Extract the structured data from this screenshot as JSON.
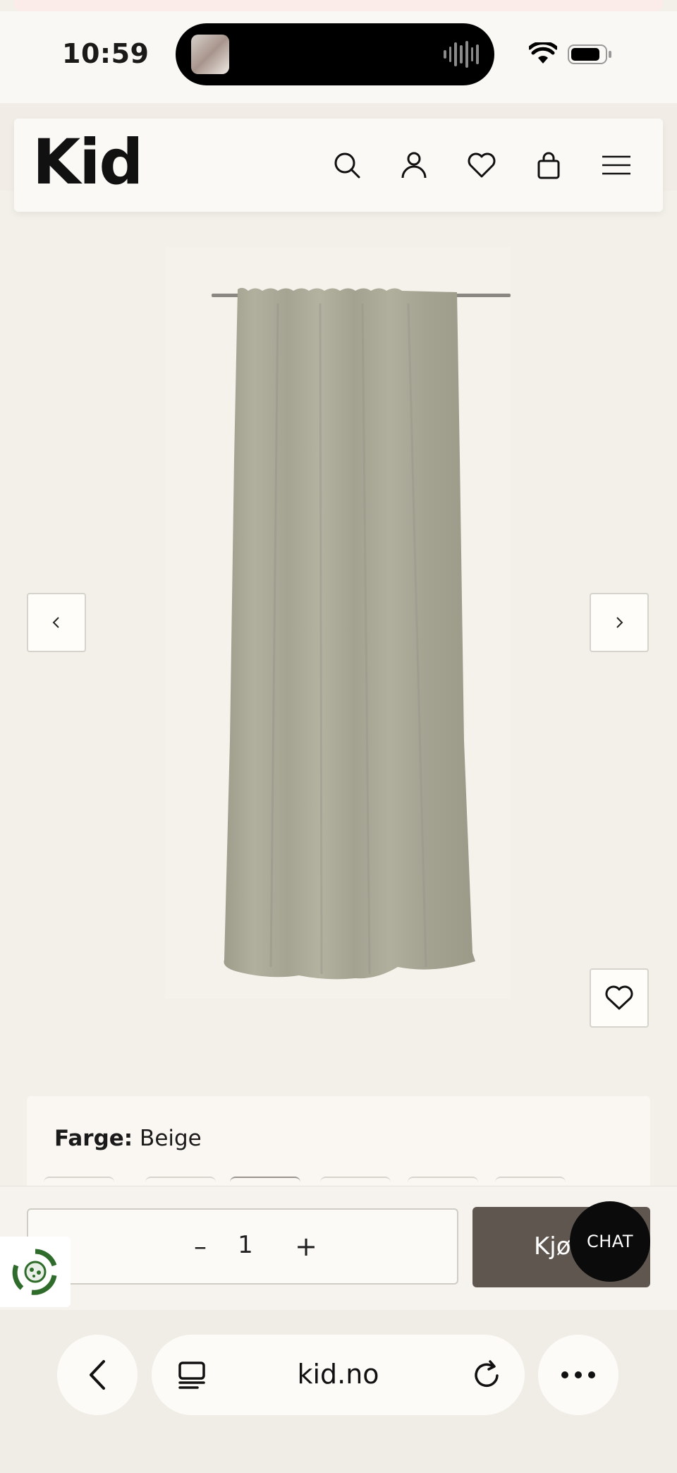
{
  "status_bar": {
    "time": "10:59"
  },
  "header": {
    "logo": "Kid",
    "icons": [
      "search-icon",
      "account-icon",
      "heart-icon",
      "bag-icon",
      "menu-icon"
    ]
  },
  "product": {
    "image_icon": "curtain-image",
    "color_label": "Farge:",
    "color_value": "Beige"
  },
  "buy_bar": {
    "quantity": "1",
    "minus": "–",
    "plus": "+",
    "buy_label": "Kjø",
    "chat_label": "CHAT"
  },
  "browser": {
    "url": "kid.no"
  },
  "colors": {
    "buy_button": "#5f5650",
    "page_bg": "#f3efe9"
  }
}
